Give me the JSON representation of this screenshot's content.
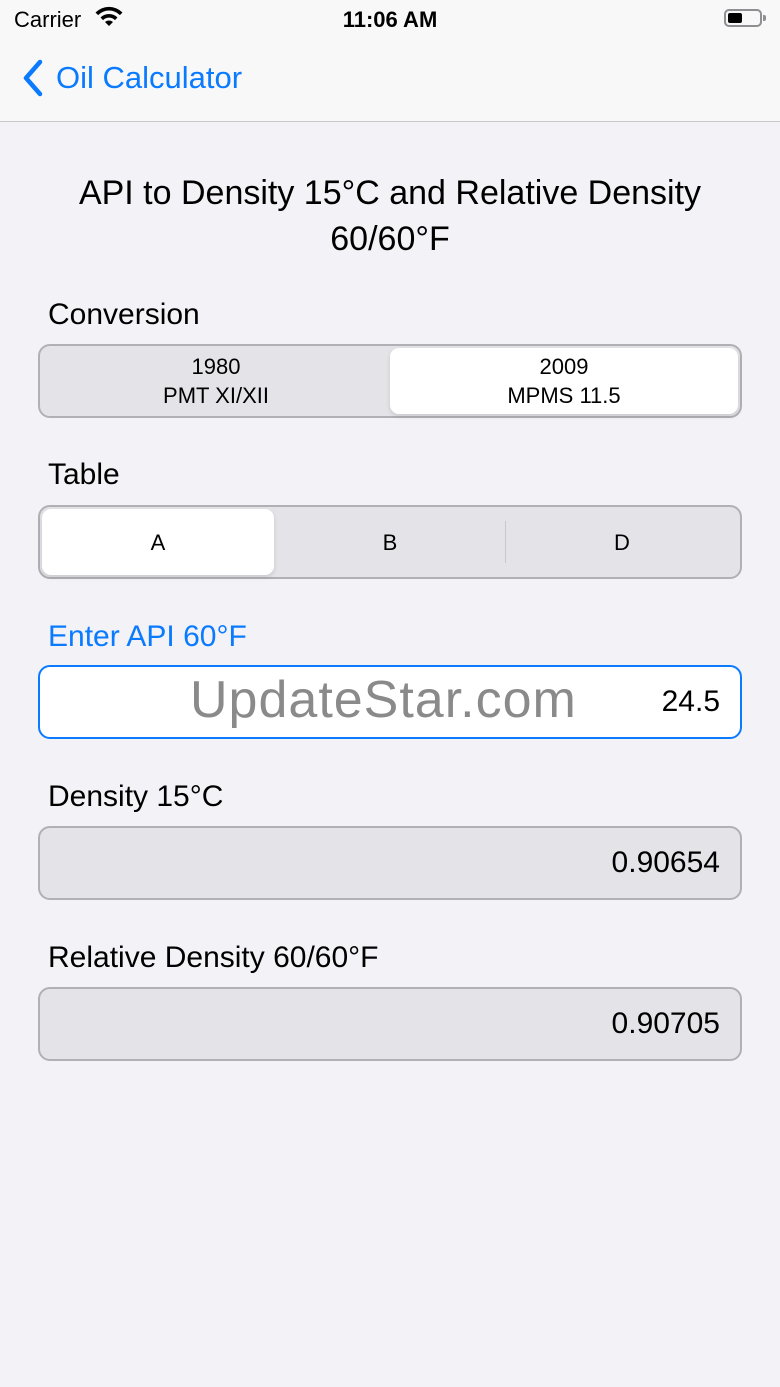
{
  "status_bar": {
    "carrier": "Carrier",
    "time": "11:06 AM"
  },
  "nav": {
    "back_label": "Oil Calculator"
  },
  "title_line1": "API to Density 15°C and Relative Density",
  "title_line2": "60/60°F",
  "conversion": {
    "label": "Conversion",
    "options": [
      {
        "line1": "1980",
        "line2": "PMT XI/XII"
      },
      {
        "line1": "2009",
        "line2": "MPMS 11.5"
      }
    ],
    "selected": "2009 MPMS 11.5"
  },
  "table": {
    "label": "Table",
    "options": [
      "A",
      "B",
      "D"
    ],
    "selected": "A"
  },
  "api_input": {
    "label": "Enter API 60°F",
    "value": "24.5"
  },
  "density": {
    "label": "Density 15°C",
    "value": "0.90654"
  },
  "relative_density": {
    "label": "Relative Density 60/60°F",
    "value": "0.90705"
  },
  "watermark": "UpdateStar.com",
  "colors": {
    "accent": "#0a7aff",
    "background": "#f2f2f7"
  }
}
